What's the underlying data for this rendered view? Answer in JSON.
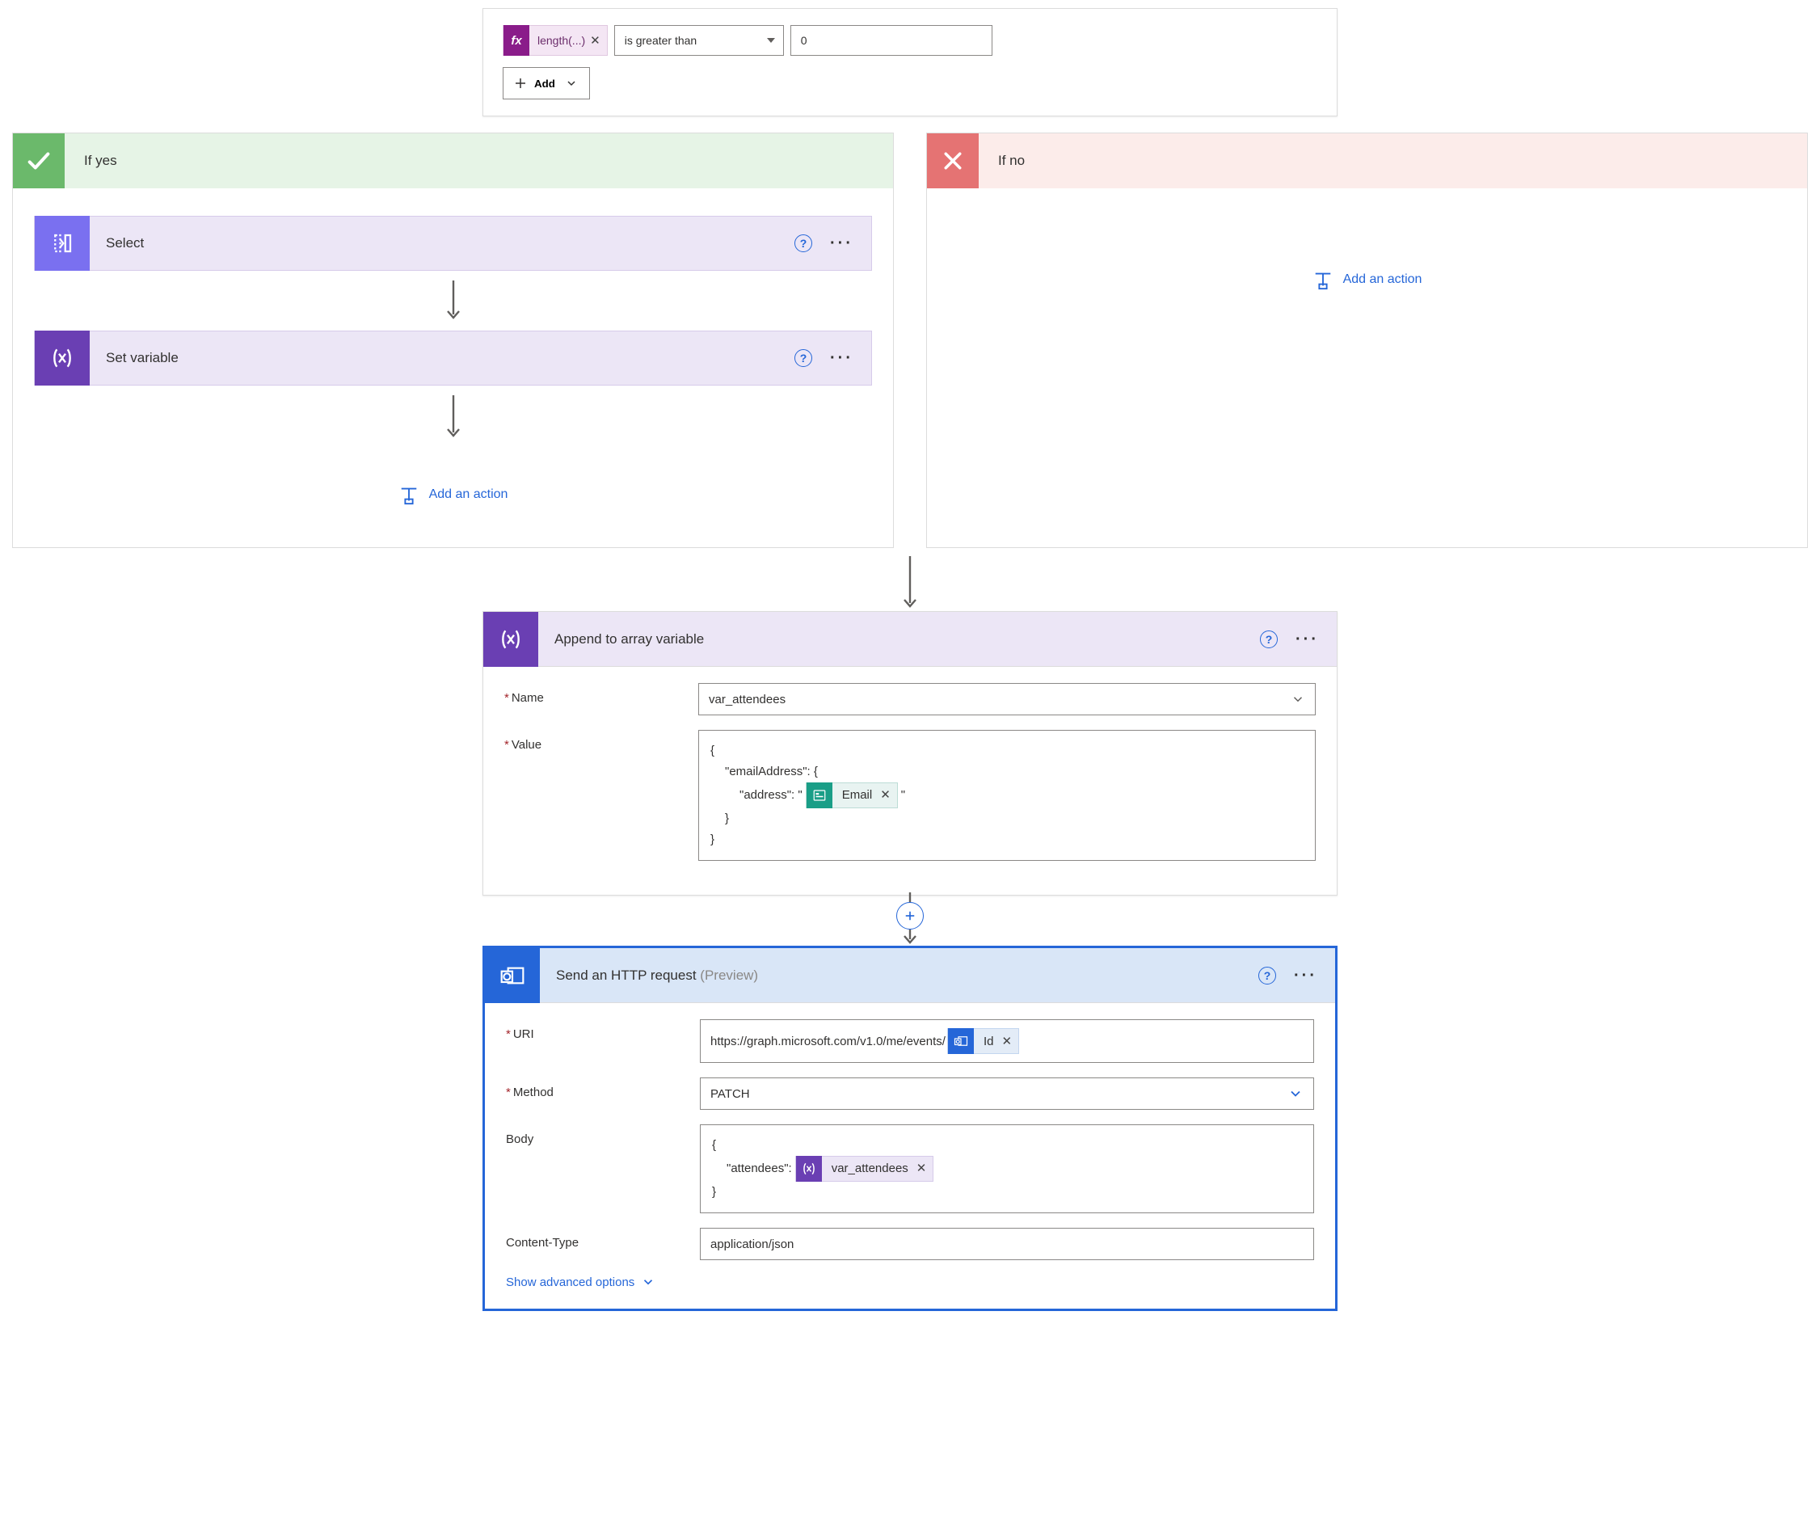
{
  "condition": {
    "fx_label": "length(...)",
    "operator": "is greater than",
    "value": "0",
    "add_btn": "Add"
  },
  "branches": {
    "yes_label": "If yes",
    "no_label": "If no",
    "select_card": "Select",
    "setvar_card": "Set variable",
    "add_action": "Add an action"
  },
  "append": {
    "title": "Append to array variable",
    "name_label": "Name",
    "name_value": "var_attendees",
    "value_label": "Value",
    "l1": "{",
    "l2": "\"emailAddress\": {",
    "l3a": "\"address\": \"",
    "l3_token": "Email",
    "l3b": "\"",
    "l4": "}",
    "l5": "}"
  },
  "http": {
    "title": "Send an HTTP request",
    "preview": "(Preview)",
    "uri_label": "URI",
    "uri_value": "https://graph.microsoft.com/v1.0/me/events/",
    "uri_token": "Id",
    "method_label": "Method",
    "method_value": "PATCH",
    "body_label": "Body",
    "b1": "{",
    "b2a": "\"attendees\":",
    "b2_token": "var_attendees",
    "b3": "}",
    "ct_label": "Content-Type",
    "ct_value": "application/json",
    "adv": "Show advanced options"
  }
}
